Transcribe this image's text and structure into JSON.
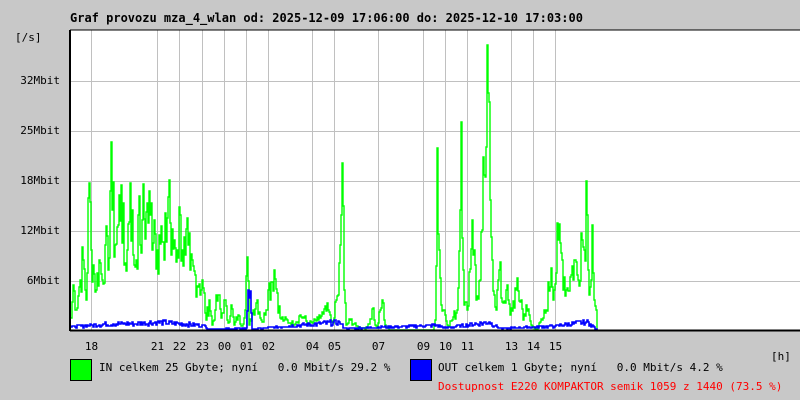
{
  "chart_data": {
    "type": "line",
    "title": "Graf provozu mza_4_wlan od: 2025-12-09 17:06:00 do: 2025-12-10 17:03:00",
    "ylabel": "[/s]",
    "xlabel": "[h]",
    "x_unit": "hours since 2025-12-09 18:00",
    "ylim": [
      0,
      38
    ],
    "y_ticks": [
      {
        "value": 6,
        "label": "6Mbit"
      },
      {
        "value": 12,
        "label": "12Mbit"
      },
      {
        "value": 18,
        "label": "18Mbit"
      },
      {
        "value": 25,
        "label": "25Mbit"
      },
      {
        "value": 32,
        "label": "32Mbit"
      }
    ],
    "x_ticks": [
      {
        "value": 0,
        "label": "18"
      },
      {
        "value": 3,
        "label": "21"
      },
      {
        "value": 4,
        "label": "22"
      },
      {
        "value": 5,
        "label": "23"
      },
      {
        "value": 6,
        "label": "00"
      },
      {
        "value": 7,
        "label": "01"
      },
      {
        "value": 8,
        "label": "02"
      },
      {
        "value": 10,
        "label": "04"
      },
      {
        "value": 11,
        "label": "05"
      },
      {
        "value": 13,
        "label": "07"
      },
      {
        "value": 15,
        "label": "09"
      },
      {
        "value": 16,
        "label": "10"
      },
      {
        "value": 17,
        "label": "11"
      },
      {
        "value": 19,
        "label": "13"
      },
      {
        "value": 20,
        "label": "14"
      },
      {
        "value": 21,
        "label": "15"
      }
    ],
    "grid": true,
    "series": [
      {
        "name": "IN",
        "color": "#00ff00",
        "points": [
          [
            -0.9,
            1.5
          ],
          [
            -0.81,
            5.8
          ],
          [
            -0.67,
            2.6
          ],
          [
            -0.49,
            6.4
          ],
          [
            -0.36,
            9.0
          ],
          [
            -0.22,
            3.8
          ],
          [
            -0.09,
            18.8
          ],
          [
            0,
            10.3
          ],
          [
            0.09,
            8.3
          ],
          [
            0.22,
            5.1
          ],
          [
            0.36,
            9.0
          ],
          [
            0.49,
            6.4
          ],
          [
            0.63,
            10.9
          ],
          [
            0.76,
            7.7
          ],
          [
            0.9,
            24.1
          ],
          [
            0.94,
            15.4
          ],
          [
            1.08,
            10.9
          ],
          [
            1.21,
            13.5
          ],
          [
            1.35,
            18.6
          ],
          [
            1.48,
            8.3
          ],
          [
            1.61,
            10.3
          ],
          [
            1.75,
            18.8
          ],
          [
            1.88,
            9.6
          ],
          [
            2.02,
            9.0
          ],
          [
            2.11,
            14.7
          ],
          [
            2.2,
            10.9
          ],
          [
            2.33,
            14.1
          ],
          [
            2.47,
            15.1
          ],
          [
            2.65,
            14.7
          ],
          [
            2.87,
            14.1
          ],
          [
            3.0,
            10.3
          ],
          [
            3.09,
            12.2
          ],
          [
            3.23,
            11.3
          ],
          [
            3.32,
            9.0
          ],
          [
            3.54,
            19.2
          ],
          [
            3.63,
            9.6
          ],
          [
            3.77,
            11.5
          ],
          [
            3.9,
            10.3
          ],
          [
            4.04,
            14.7
          ],
          [
            4.13,
            10.3
          ],
          [
            4.26,
            9.6
          ],
          [
            4.39,
            10.9
          ],
          [
            4.48,
            7.7
          ],
          [
            4.71,
            7.1
          ],
          [
            4.89,
            5.9
          ],
          [
            5.07,
            5.4
          ],
          [
            5.2,
            1.3
          ],
          [
            5.34,
            3.8
          ],
          [
            5.47,
            0.6
          ],
          [
            5.61,
            2.6
          ],
          [
            5.74,
            4.5
          ],
          [
            5.87,
            1.5
          ],
          [
            6.01,
            3.8
          ],
          [
            6.19,
            0.9
          ],
          [
            6.32,
            3.2
          ],
          [
            6.46,
            0.6
          ],
          [
            6.64,
            1.9
          ],
          [
            6.77,
            0.5
          ],
          [
            6.91,
            1.5
          ],
          [
            7.04,
            9.4
          ],
          [
            7.13,
            0.6
          ],
          [
            7.31,
            2.6
          ],
          [
            7.49,
            3.8
          ],
          [
            7.67,
            1.3
          ],
          [
            7.8,
            1.0
          ],
          [
            8.03,
            5.1
          ],
          [
            8.16,
            6.2
          ],
          [
            8.3,
            7.7
          ],
          [
            8.43,
            4.7
          ],
          [
            8.57,
            1.5
          ],
          [
            8.74,
            1.3
          ],
          [
            9.01,
            0.9
          ],
          [
            9.28,
            1.0
          ],
          [
            9.46,
            1.9
          ],
          [
            9.64,
            1.5
          ],
          [
            9.82,
            0.8
          ],
          [
            10.04,
            1.0
          ],
          [
            10.27,
            1.3
          ],
          [
            10.49,
            2.1
          ],
          [
            10.72,
            2.6
          ],
          [
            10.85,
            1.0
          ],
          [
            10.99,
            1.5
          ],
          [
            11.08,
            3.8
          ],
          [
            11.17,
            4.5
          ],
          [
            11.26,
            10.9
          ],
          [
            11.35,
            21.4
          ],
          [
            11.44,
            5.1
          ],
          [
            11.52,
            0.6
          ],
          [
            11.7,
            1.3
          ],
          [
            11.97,
            0.5
          ],
          [
            12.2,
            0.3
          ],
          [
            12.51,
            0.3
          ],
          [
            12.78,
            2.8
          ],
          [
            12.87,
            0.6
          ],
          [
            12.96,
            0.3
          ],
          [
            13.18,
            3.8
          ],
          [
            13.32,
            0.6
          ],
          [
            13.5,
            0
          ],
          [
            15.47,
            0
          ],
          [
            15.56,
            1.3
          ],
          [
            15.65,
            23.3
          ],
          [
            15.74,
            10.3
          ],
          [
            15.83,
            3.2
          ],
          [
            15.96,
            2.6
          ],
          [
            16.1,
            0.6
          ],
          [
            16.32,
            1.3
          ],
          [
            16.55,
            2.6
          ],
          [
            16.68,
            15.4
          ],
          [
            16.73,
            26.7
          ],
          [
            16.86,
            3.2
          ],
          [
            17.0,
            2.6
          ],
          [
            17.22,
            14.1
          ],
          [
            17.35,
            10.3
          ],
          [
            17.44,
            3.8
          ],
          [
            17.58,
            6.4
          ],
          [
            17.71,
            12.8
          ],
          [
            17.8,
            19.9
          ],
          [
            17.89,
            23.5
          ],
          [
            17.98,
            30.4
          ],
          [
            18.07,
            16.7
          ],
          [
            18.16,
            9.0
          ],
          [
            18.34,
            2.6
          ],
          [
            18.48,
            7.7
          ],
          [
            18.61,
            3.6
          ],
          [
            18.79,
            5.1
          ],
          [
            18.97,
            1.9
          ],
          [
            19.24,
            5.1
          ],
          [
            19.46,
            3.8
          ],
          [
            19.55,
            1.3
          ],
          [
            19.69,
            3.2
          ],
          [
            19.91,
            0.6
          ],
          [
            20.13,
            0
          ],
          [
            20.4,
            1.3
          ],
          [
            20.58,
            2.6
          ],
          [
            20.81,
            7.9
          ],
          [
            20.94,
            5.1
          ],
          [
            21.12,
            11.5
          ],
          [
            21.3,
            9.0
          ],
          [
            21.48,
            5.1
          ],
          [
            21.7,
            7.1
          ],
          [
            21.84,
            9.0
          ],
          [
            22.02,
            6.4
          ],
          [
            22.15,
            12.4
          ],
          [
            22.29,
            10.3
          ],
          [
            22.38,
            19.1
          ],
          [
            22.47,
            7.7
          ],
          [
            22.56,
            5.5
          ],
          [
            22.65,
            13.5
          ],
          [
            22.74,
            3.8
          ],
          [
            22.83,
            2.6
          ],
          [
            22.91,
            0
          ]
        ]
      },
      {
        "name": "OUT",
        "color": "#0000ff",
        "points": [
          [
            -0.9,
            0.4
          ],
          [
            0,
            0.6
          ],
          [
            1.0,
            0.8
          ],
          [
            2.0,
            0.8
          ],
          [
            3.0,
            1.0
          ],
          [
            4.0,
            0.8
          ],
          [
            5.0,
            0.6
          ],
          [
            5.4,
            0.1
          ],
          [
            7.0,
            0.2
          ],
          [
            7.1,
            5.1
          ],
          [
            7.2,
            5.0
          ],
          [
            7.3,
            0.1
          ],
          [
            11.2,
            1.0
          ],
          [
            11.5,
            0.2
          ],
          [
            15.6,
            0.6
          ],
          [
            16.0,
            0.3
          ],
          [
            18.0,
            1.0
          ],
          [
            18.5,
            0.2
          ],
          [
            21.0,
            0.5
          ],
          [
            22.4,
            1.0
          ],
          [
            22.6,
            0.8
          ],
          [
            22.9,
            0
          ]
        ]
      }
    ]
  },
  "legend": {
    "in": {
      "text": "IN celkem 25 Gbyte; nyní   0.0 Mbit/s 29.2 %",
      "color": "#00ff00"
    },
    "out": {
      "text": "OUT celkem 1 Gbyte; nyní   0.0 Mbit/s 4.2 %",
      "color": "#0000ff"
    },
    "availability": "Dostupnost E220 KOMPAKTOR semik 1059 z 1440 (73.5 %)"
  }
}
